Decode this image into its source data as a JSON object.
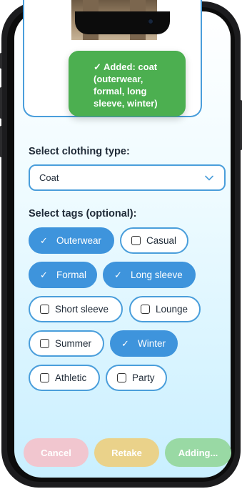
{
  "preview": {
    "toast_text": "✓ Added: coat (outerwear, formal, long sleeve, winter)"
  },
  "clothing_type": {
    "label": "Select clothing type:",
    "selected": "Coat"
  },
  "tags": {
    "label": "Select tags (optional):",
    "items": [
      {
        "label": "Outerwear",
        "selected": true
      },
      {
        "label": "Casual",
        "selected": false
      },
      {
        "label": "Formal",
        "selected": true
      },
      {
        "label": "Long sleeve",
        "selected": true
      },
      {
        "label": "Short sleeve",
        "selected": false
      },
      {
        "label": "Lounge",
        "selected": false
      },
      {
        "label": "Summer",
        "selected": false
      },
      {
        "label": "Winter",
        "selected": true
      },
      {
        "label": "Athletic",
        "selected": false
      },
      {
        "label": "Party",
        "selected": false
      }
    ]
  },
  "actions": {
    "cancel": "Cancel",
    "retake": "Retake",
    "adding": "Adding..."
  },
  "colors": {
    "accent": "#3e94dc",
    "toast": "#4caf50",
    "cancel": "#f1c6cf",
    "retake": "#ead28a",
    "adding": "#99d9a4"
  },
  "icons": {
    "select_chevron": "chevron-down-icon",
    "selected_tag": "check-icon",
    "unselected_tag": "checkbox-empty-icon"
  }
}
